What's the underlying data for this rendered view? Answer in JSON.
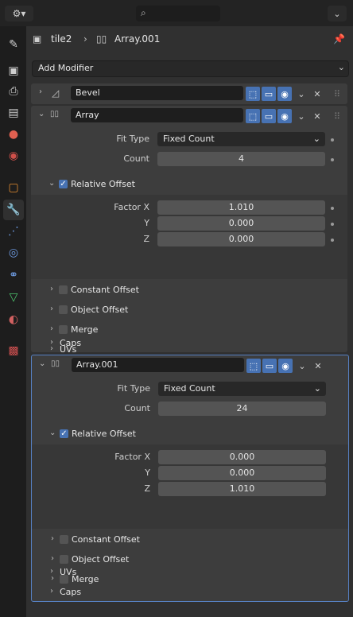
{
  "breadcrumb": {
    "object": "tile2",
    "modifier": "Array.001"
  },
  "add_modifier_label": "Add Modifier",
  "modifiers": [
    {
      "name": "Bevel"
    },
    {
      "name": "Array",
      "fit_type_label": "Fit Type",
      "fit_type_value": "Fixed Count",
      "count_label": "Count",
      "count_value": "4",
      "relative_offset_label": "Relative Offset",
      "factor_x_label": "Factor X",
      "factor_x": "1.010",
      "y_label": "Y",
      "y": "0.000",
      "z_label": "Z",
      "z": "0.000",
      "sections": [
        "Constant Offset",
        "Object Offset",
        "Merge",
        "UVs",
        "Caps"
      ]
    },
    {
      "name": "Array.001",
      "fit_type_label": "Fit Type",
      "fit_type_value": "Fixed Count",
      "count_label": "Count",
      "count_value": "24",
      "relative_offset_label": "Relative Offset",
      "factor_x_label": "Factor X",
      "factor_x": "0.000",
      "y_label": "Y",
      "y": "0.000",
      "z_label": "Z",
      "z": "1.010",
      "sections": [
        "Constant Offset",
        "Object Offset",
        "Merge",
        "UVs",
        "Caps"
      ]
    }
  ],
  "colors": {
    "accent": "#4772b3",
    "selected_border": "#5680c2"
  }
}
